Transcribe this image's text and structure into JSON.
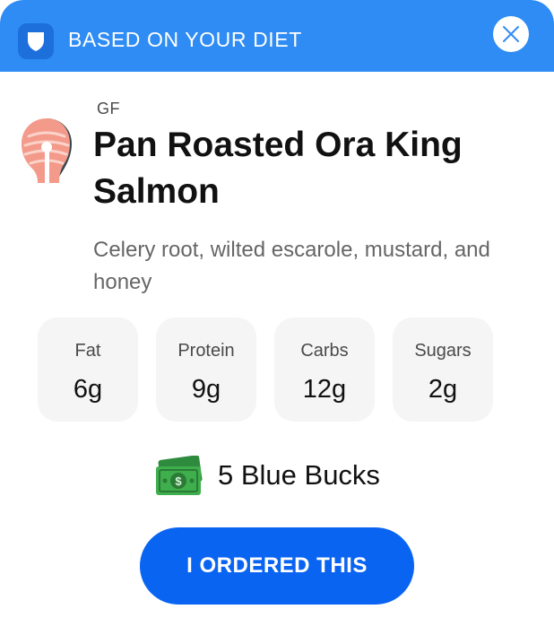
{
  "header": {
    "title": "BASED ON YOUR DIET",
    "icon": "shield-icon",
    "close_icon": "close-icon",
    "color": "#2f8cf4"
  },
  "dish": {
    "icon": "salmon-steak-icon",
    "tag": "GF",
    "title": "Pan Roasted Ora King Salmon",
    "description": "Celery root, wilted escarole, mustard, and honey"
  },
  "nutrients": [
    {
      "label": "Fat",
      "value": "6g"
    },
    {
      "label": "Protein",
      "value": "9g"
    },
    {
      "label": "Carbs",
      "value": "12g"
    },
    {
      "label": "Sugars",
      "value": "2g"
    }
  ],
  "reward": {
    "icon": "money-icon",
    "label": "5 Blue Bucks"
  },
  "action": {
    "label": "I ORDERED THIS",
    "color": "#0a64f2"
  }
}
